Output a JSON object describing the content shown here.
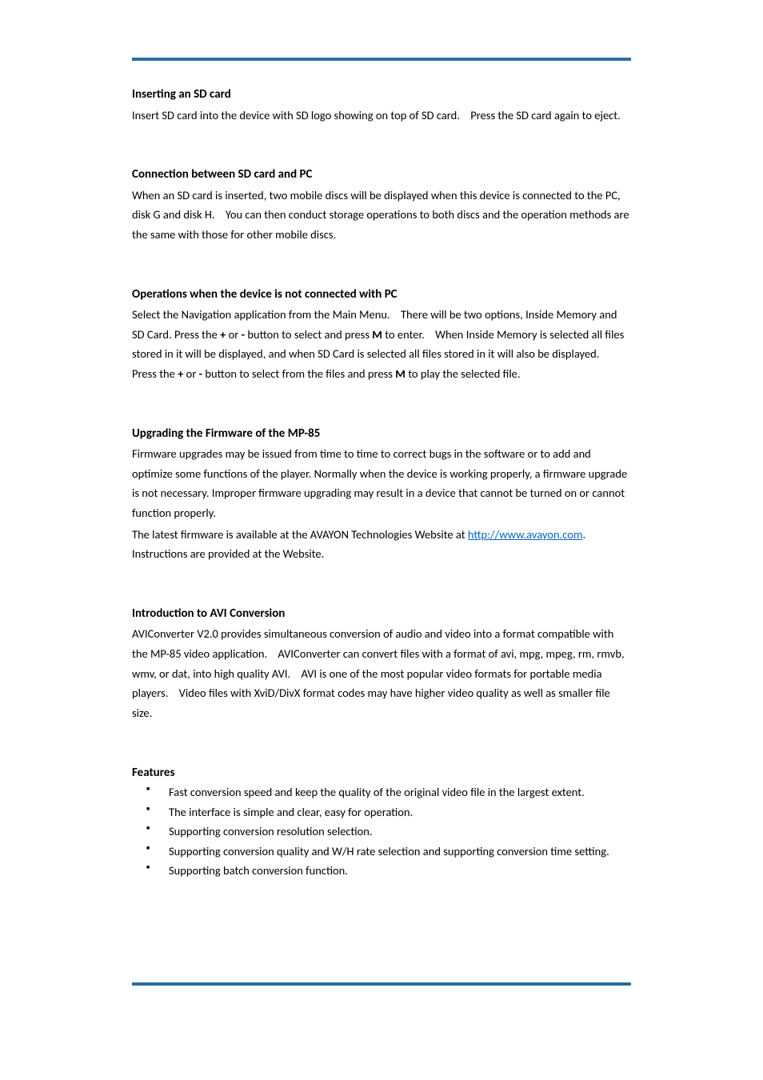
{
  "s1": {
    "heading": "Inserting an SD card",
    "p1a": "Insert SD card into the device with SD logo showing on top of SD card.",
    "p1b": "Press the SD card again to eject."
  },
  "s2": {
    "heading": "Connection between SD card and PC",
    "p1a": "When an SD card is inserted, two mobile discs will be displayed when this device is connected to the PC, disk G and disk H.",
    "p1b": "You can then conduct storage operations to both discs and the operation methods are the same with those for other mobile discs."
  },
  "s3": {
    "heading": "Operations when the device is not connected with PC",
    "p1a": "Select the Navigation application from the Main Menu.",
    "p1b": "There will be two options, Inside Memory and SD Card. Press the ",
    "plus": "+",
    "p1c": " or ",
    "minus": "-",
    "p1d": " button to select and press ",
    "M": "M",
    "p1e": " to enter.",
    "p1f": "When Inside Memory is selected all files stored in it will be displayed, and when SD Card is selected all files stored in it will also be displayed.",
    "p1g": "Press the ",
    "p1h": " button to select from the files and press ",
    "p1i": " to play the selected file."
  },
  "s4": {
    "heading": "Upgrading the Firmware of the MP-85",
    "p1": "Firmware upgrades may be issued from time to time to correct bugs in the software or to add and optimize some functions of the player. Normally when the device is working properly, a firmware upgrade is not necessary. Improper firmware upgrading may result in a device that cannot be turned on or cannot function properly.",
    "p2a": "The latest firmware is available at the AVAYON Technologies Website at ",
    "link_text": "http://www.avayon.com",
    "link_href": "http://www.avayon.com",
    "p2b": ". Instructions are provided at the Website."
  },
  "s5": {
    "heading": "Introduction to AVI Conversion",
    "p1a": "AVIConverter V2.0 provides simultaneous conversion of audio and video into a format compatible with the MP-85 video application.",
    "p1b": "AVIConverter can convert files with a format of avi, mpg, mpeg, rm, rmvb, wmv, or dat, into high quality AVI.",
    "p1c": "AVI is one of the most popular video formats for portable media players.",
    "p1d": "Video files with XviD/DivX format codes may have higher video quality as well as smaller file size."
  },
  "s6": {
    "heading": "Features",
    "items": [
      "Fast conversion speed and keep the quality of the original video file in the largest extent.",
      "The interface is simple and clear, easy for operation.",
      "Supporting conversion resolution selection.",
      "Supporting conversion quality and W/H rate selection and supporting conversion time setting.",
      "Supporting batch conversion function."
    ]
  }
}
